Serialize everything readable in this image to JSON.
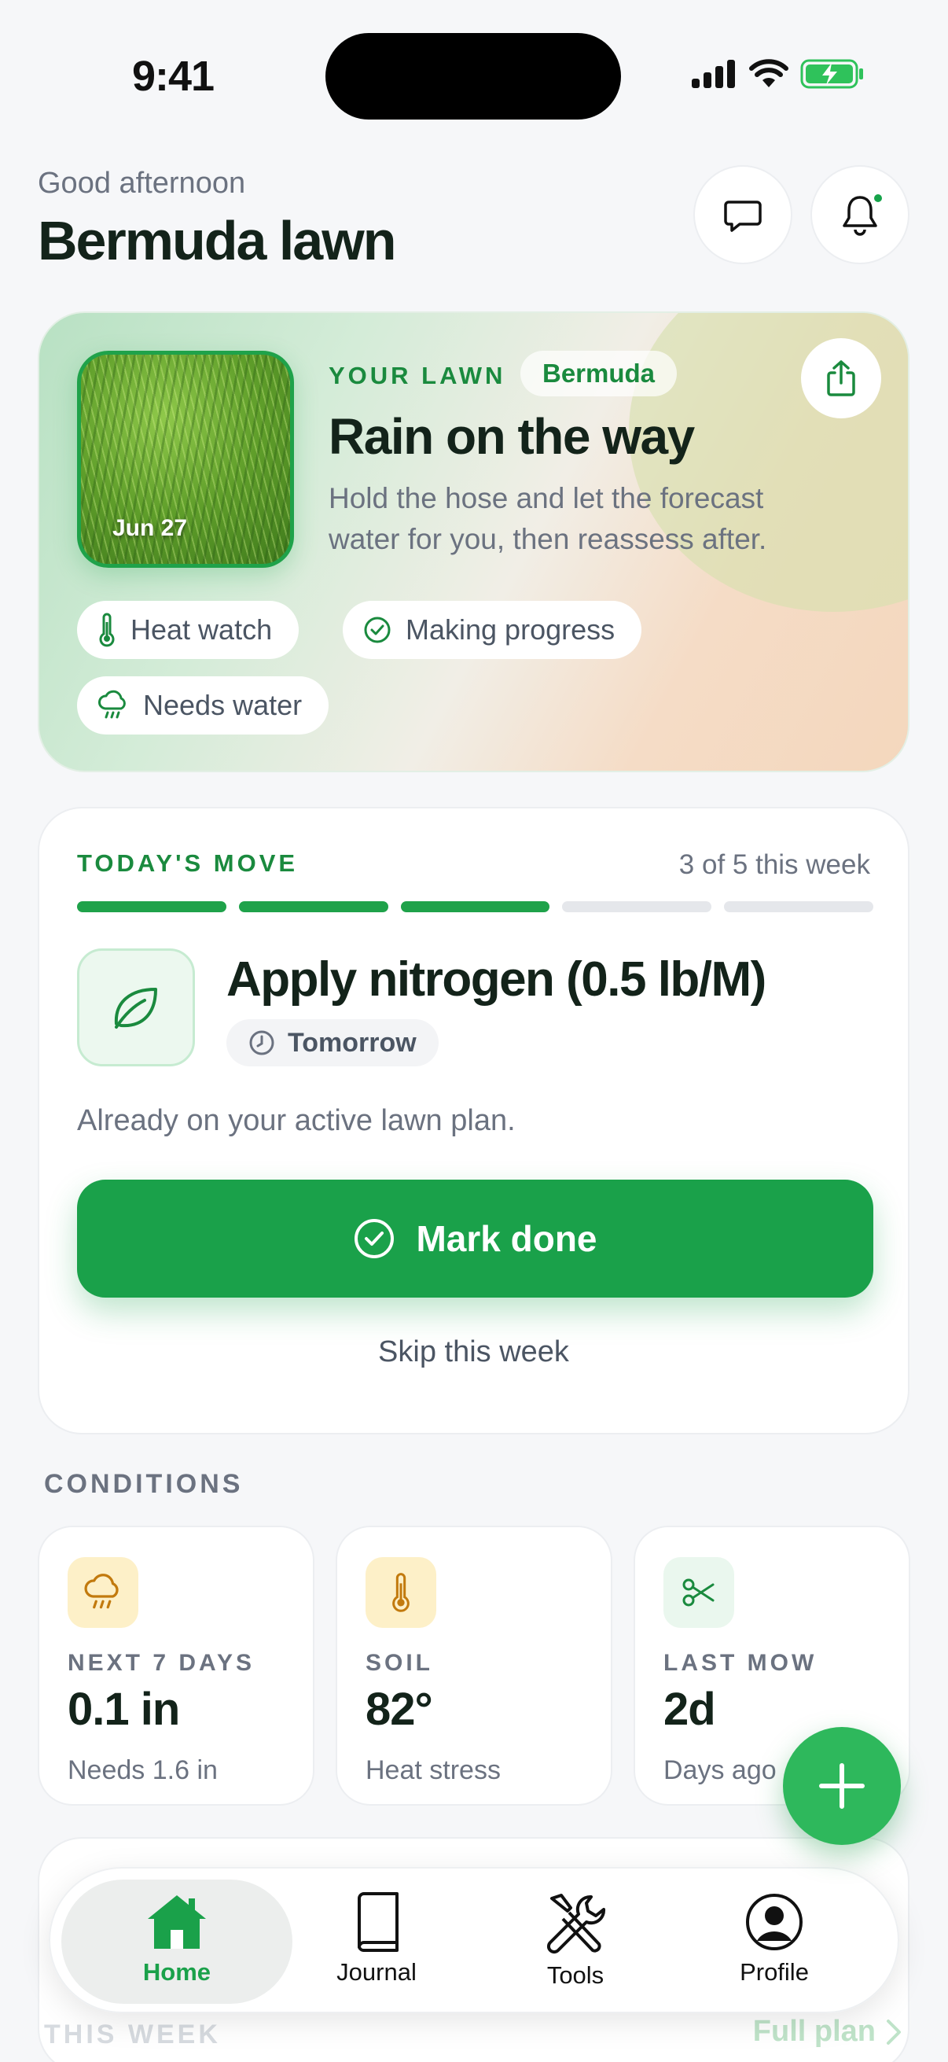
{
  "status_bar": {
    "time": "9:41"
  },
  "header": {
    "greeting": "Good afternoon",
    "title": "Bermuda lawn"
  },
  "hero": {
    "photo_date": "Jun 27",
    "eyebrow": "YOUR LAWN",
    "grass_type": "Bermuda",
    "title": "Rain on the way",
    "description": "Hold the hose and let the forecast water for you, then reassess after.",
    "chips": [
      {
        "label": "Heat watch",
        "icon": "thermometer-icon"
      },
      {
        "label": "Making progress",
        "icon": "check-circle-icon"
      },
      {
        "label": "Needs water",
        "icon": "rain-cloud-icon"
      }
    ]
  },
  "today_move": {
    "eyebrow": "TODAY'S MOVE",
    "count": "3 of 5 this week",
    "progress": {
      "done": 3,
      "total": 5
    },
    "task_title": "Apply nitrogen (0.5 lb/M)",
    "due": "Tomorrow",
    "note": "Already on your active lawn plan.",
    "primary_action": "Mark done",
    "secondary_action": "Skip this week"
  },
  "conditions": {
    "label": "CONDITIONS",
    "cards": [
      {
        "label": "NEXT 7 DAYS",
        "value": "0.1 in",
        "sub": "Needs 1.6 in",
        "icon": "rain-cloud-icon"
      },
      {
        "label": "SOIL",
        "value": "82°",
        "sub": "Heat stress",
        "icon": "thermometer-icon"
      },
      {
        "label": "LAST MOW",
        "value": "2d",
        "sub": "Days ago",
        "icon": "scissors-icon"
      }
    ]
  },
  "this_week": {
    "label": "THIS WEEK",
    "link": "Full plan"
  },
  "tab_bar": {
    "tabs": [
      {
        "label": "Home",
        "icon": "house-icon",
        "active": true
      },
      {
        "label": "Journal",
        "icon": "book-icon",
        "active": false
      },
      {
        "label": "Tools",
        "icon": "tools-icon",
        "active": false
      },
      {
        "label": "Profile",
        "icon": "person-circle-icon",
        "active": false
      }
    ]
  },
  "colors": {
    "accent": "#1aa14a",
    "text": "#13231a",
    "muted": "#6b7280",
    "warning_bg": "#fdf0c8"
  }
}
